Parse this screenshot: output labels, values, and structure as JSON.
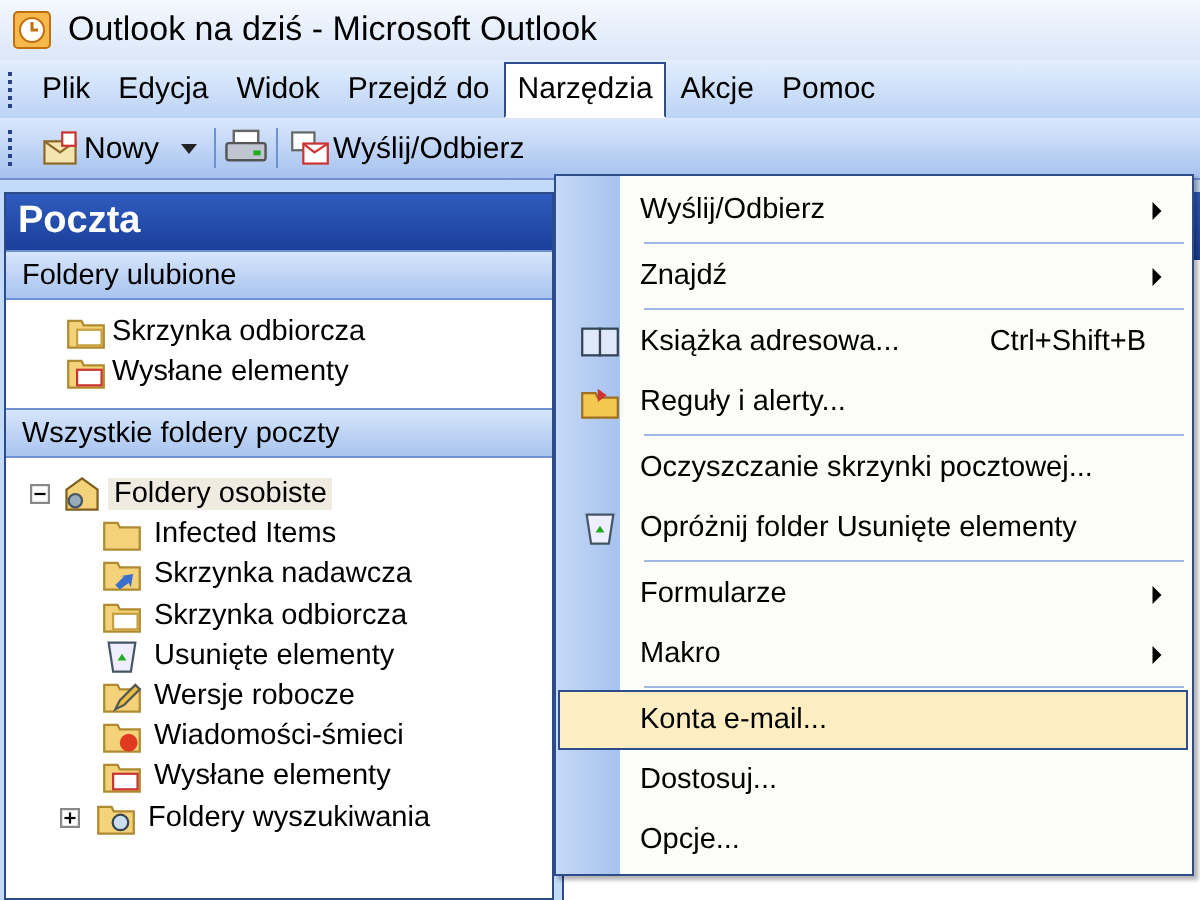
{
  "window": {
    "title": "Outlook na dziś - Microsoft Outlook"
  },
  "menu_bar": [
    {
      "label": "Plik",
      "selected": false
    },
    {
      "label": "Edycja",
      "selected": false
    },
    {
      "label": "Widok",
      "selected": false
    },
    {
      "label": "Przejdź do",
      "selected": false
    },
    {
      "label": "Narzędzia",
      "selected": true
    },
    {
      "label": "Akcje",
      "selected": false
    },
    {
      "label": "Pomoc",
      "selected": false
    }
  ],
  "toolbar": {
    "new_button": "Nowy",
    "send_receive_button": "Wyślij/Odbierz"
  },
  "navigation": {
    "title": "Poczta",
    "favorites": {
      "header": "Foldery ulubione",
      "items": [
        "Skrzynka odbiorcza",
        "Wysłane elementy"
      ]
    },
    "all_folders": {
      "header": "Wszystkie foldery poczty",
      "tree": [
        {
          "label": "Foldery osobiste",
          "expanded": true,
          "selected": true,
          "children": [
            {
              "label": "Infected Items"
            },
            {
              "label": "Skrzynka nadawcza"
            },
            {
              "label": "Skrzynka odbiorcza"
            },
            {
              "label": "Usunięte elementy"
            },
            {
              "label": "Wersje robocze"
            },
            {
              "label": "Wiadomości-śmieci"
            },
            {
              "label": "Wysłane elementy"
            },
            {
              "label": "Foldery wyszukiwania",
              "expanded": false
            }
          ]
        }
      ]
    }
  },
  "tools_menu": [
    {
      "label": "Wyślij/Odbierz",
      "submenu": true,
      "divider_above": false,
      "selected": false
    },
    {
      "label": "Znajdź",
      "submenu": true,
      "divider_above": true,
      "selected": false
    },
    {
      "label": "Książka adresowa...",
      "shortcut": "Ctrl+Shift+B",
      "submenu": false,
      "divider_above": true,
      "selected": false
    },
    {
      "label": "Reguły i alerty...",
      "submenu": false,
      "divider_above": false,
      "selected": false
    },
    {
      "label": "Oczyszczanie skrzynki pocztowej...",
      "submenu": false,
      "divider_above": true,
      "selected": false
    },
    {
      "label": "Opróżnij folder Usunięte elementy",
      "submenu": false,
      "divider_above": false,
      "selected": false
    },
    {
      "label": "Formularze",
      "submenu": true,
      "divider_above": true,
      "selected": false
    },
    {
      "label": "Makro",
      "submenu": true,
      "divider_above": false,
      "selected": false
    },
    {
      "label": "Konta e-mail...",
      "submenu": false,
      "divider_above": true,
      "selected": true
    },
    {
      "label": "Dostosuj...",
      "submenu": false,
      "divider_above": false,
      "selected": false
    },
    {
      "label": "Opcje...",
      "submenu": false,
      "divider_above": false,
      "selected": false
    }
  ]
}
